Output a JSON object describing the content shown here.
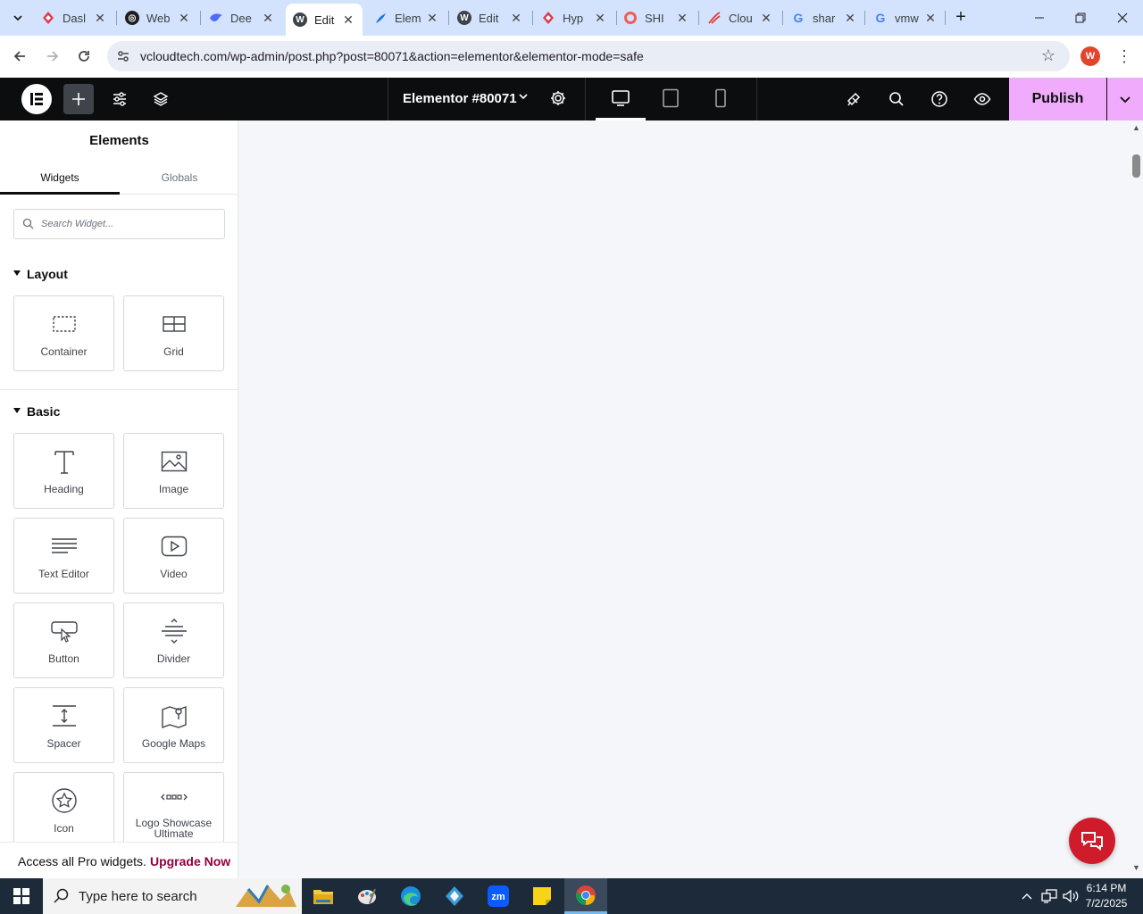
{
  "browser": {
    "tabs": [
      {
        "title": "Dasl",
        "icon": "hyperise-icon",
        "color": "#e03b4c"
      },
      {
        "title": "Web",
        "icon": "openai-icon",
        "color": "#1f1f1f"
      },
      {
        "title": "Dee",
        "icon": "deepseek-icon",
        "color": "#4d6bfe"
      },
      {
        "title": "Edit",
        "icon": "wordpress-icon",
        "color": "#3c434a"
      },
      {
        "title": "Elem",
        "icon": "elementor-feather-icon",
        "color": "#1a73e8"
      },
      {
        "title": "Edit",
        "icon": "wordpress-icon",
        "color": "#3c434a"
      },
      {
        "title": "Hyp",
        "icon": "hyperise-icon",
        "color": "#e03b4c"
      },
      {
        "title": "SHI",
        "icon": "shi-ring-icon",
        "color": "#f25c54"
      },
      {
        "title": "Clou",
        "icon": "cloud-stroke-icon",
        "color": "#e53935"
      },
      {
        "title": "shar",
        "icon": "google-icon",
        "color": "#4285f4"
      },
      {
        "title": "vmw",
        "icon": "google-icon",
        "color": "#4285f4"
      }
    ],
    "active_tab_index": 3,
    "url": "vcloudtech.com/wp-admin/post.php?post=80071&action=elementor&elementor-mode=safe",
    "profile_initial": "W",
    "profile_color": "#e2452c"
  },
  "editor": {
    "document_title": "Elementor #80071",
    "publish_label": "Publish",
    "accent_color": "#f0abfc"
  },
  "panel": {
    "title": "Elements",
    "tabs": [
      "Widgets",
      "Globals"
    ],
    "search_placeholder": "Search Widget...",
    "categories": [
      {
        "name": "Layout",
        "widgets": [
          {
            "label": "Container",
            "icon": "container-icon"
          },
          {
            "label": "Grid",
            "icon": "grid-icon"
          }
        ]
      },
      {
        "name": "Basic",
        "widgets": [
          {
            "label": "Heading",
            "icon": "heading-icon"
          },
          {
            "label": "Image",
            "icon": "image-icon"
          },
          {
            "label": "Text Editor",
            "icon": "text-editor-icon"
          },
          {
            "label": "Video",
            "icon": "video-icon"
          },
          {
            "label": "Button",
            "icon": "button-icon"
          },
          {
            "label": "Divider",
            "icon": "divider-icon"
          },
          {
            "label": "Spacer",
            "icon": "spacer-icon"
          },
          {
            "label": "Google Maps",
            "icon": "map-icon"
          },
          {
            "label": "Icon",
            "icon": "star-icon"
          },
          {
            "label": "Logo Showcase Ultimate",
            "icon": "logo-showcase-icon"
          }
        ]
      }
    ],
    "promo_text": "Access all Pro widgets.",
    "promo_link": "Upgrade Now",
    "promo_link_color": "#93003f"
  },
  "taskbar": {
    "search_placeholder": "Type here to search",
    "apps": [
      "file-explorer-icon",
      "paint-icon",
      "edge-icon",
      "app-diamond-icon",
      "zoom-icon",
      "sticky-notes-icon",
      "chrome-icon"
    ],
    "time": "6:14 PM",
    "date": "7/2/2025"
  }
}
